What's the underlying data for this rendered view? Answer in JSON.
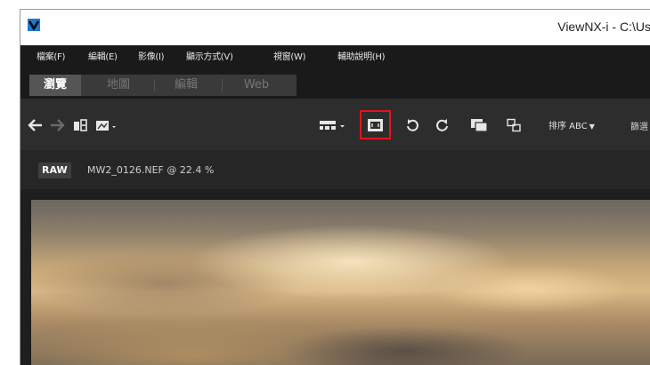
{
  "window": {
    "title": "ViewNX-i - C:\\Us"
  },
  "menubar": {
    "items": [
      {
        "label": "檔案(F)"
      },
      {
        "label": "編輯(E)"
      },
      {
        "label": "影像(I)"
      },
      {
        "label": "顯示方式(V)"
      },
      {
        "label": "視窗(W)"
      },
      {
        "label": "輔助說明(H)"
      }
    ]
  },
  "tabs": {
    "items": [
      {
        "label": "瀏覽",
        "active": true
      },
      {
        "label": "地圖",
        "active": false
      },
      {
        "label": "編輯",
        "active": false
      },
      {
        "label": "Web",
        "active": false
      }
    ]
  },
  "toolbar": {
    "icons": [
      "back-arrow-icon",
      "forward-arrow-icon",
      "import-icon",
      "export-dropdown-icon",
      "layout-dropdown-icon",
      "full-screen-icon",
      "rotate-left-icon",
      "rotate-right-icon",
      "compare-icon",
      "sync-icon"
    ],
    "sort_label": "排序 ABC",
    "extra_label": "篩選",
    "highlight_color": "#e0141e"
  },
  "infobar": {
    "badge": "RAW",
    "file_label": "MW2_0126.NEF @ 22.4 %"
  },
  "colors": {
    "titlebar_bg": "#ffffff",
    "menubar_bg": "#1a1a1a",
    "toolbar_bg": "#2d2d2d",
    "logo_blue": "#1f7ad0"
  }
}
